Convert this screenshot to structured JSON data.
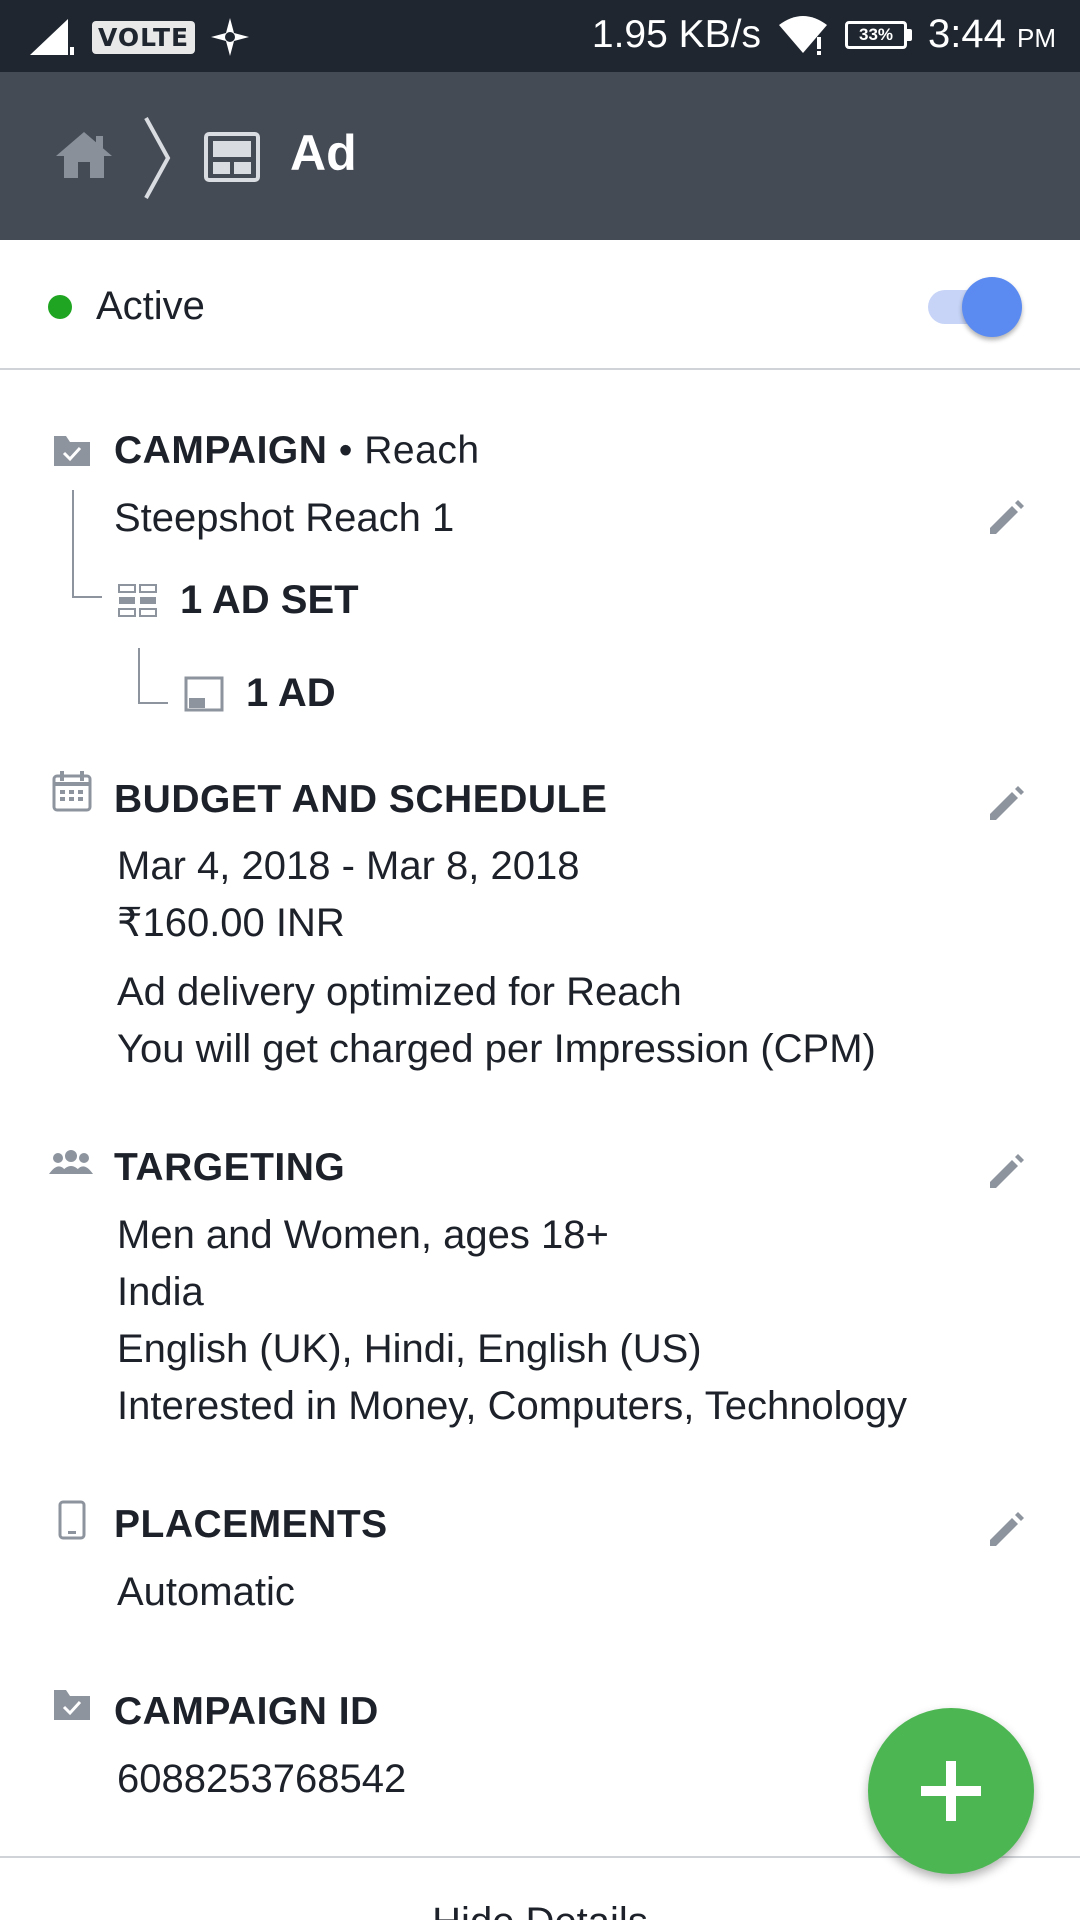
{
  "status_bar": {
    "carrier_badge": "VOLTE",
    "speed": "1.95 KB/s",
    "battery": "33%",
    "time": "3:44",
    "ampm": "PM"
  },
  "nav": {
    "title": "Ad"
  },
  "status": {
    "label": "Active",
    "toggle_on": true,
    "dot_color": "#1fa521",
    "toggle_color": "#5b8bf1"
  },
  "campaign": {
    "title": "CAMPAIGN",
    "objective": "• Reach",
    "name": "Steepshot Reach 1",
    "ad_sets": "1 AD SET",
    "ads": "1 AD"
  },
  "budget": {
    "title": "BUDGET AND SCHEDULE",
    "dates": "Mar 4, 2018 - Mar 8, 2018",
    "amount": "₹160.00 INR",
    "optimization": "Ad delivery optimized for Reach",
    "charge": "You will get charged per Impression (CPM)"
  },
  "targeting": {
    "title": "TARGETING",
    "audience": "Men and Women, ages 18+",
    "location": "India",
    "languages": "English (UK), Hindi, English (US)",
    "interests": "Interested in Money, Computers, Technology"
  },
  "placements": {
    "title": "PLACEMENTS",
    "value": "Automatic"
  },
  "campaign_id": {
    "title": "CAMPAIGN ID",
    "value": "6088253768542"
  },
  "footer": {
    "hide_details": "Hide Details"
  },
  "fab": {
    "icon": "plus-icon",
    "color": "#4cb752"
  }
}
